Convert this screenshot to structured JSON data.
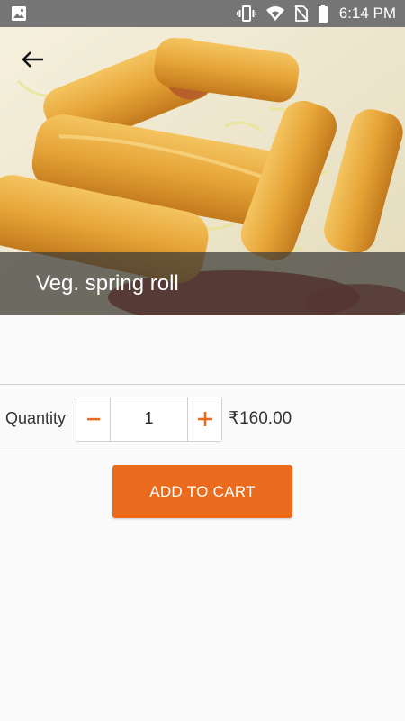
{
  "status_bar": {
    "time": "6:14 PM",
    "icons": [
      "image-icon",
      "vibrate-icon",
      "wifi-icon",
      "no-sim-icon",
      "battery-icon"
    ]
  },
  "hero": {
    "back_icon": "arrow-left-icon",
    "title": "Veg. spring roll"
  },
  "quantity": {
    "label": "Quantity",
    "value": "1",
    "decrement_symbol": "−",
    "increment_symbol": "+"
  },
  "price": "₹160.00",
  "actions": {
    "add_to_cart_label": "ADD TO CART"
  },
  "colors": {
    "accent": "#ea6a1e",
    "status_bar": "#757575",
    "title_overlay": "#3c3a37"
  }
}
